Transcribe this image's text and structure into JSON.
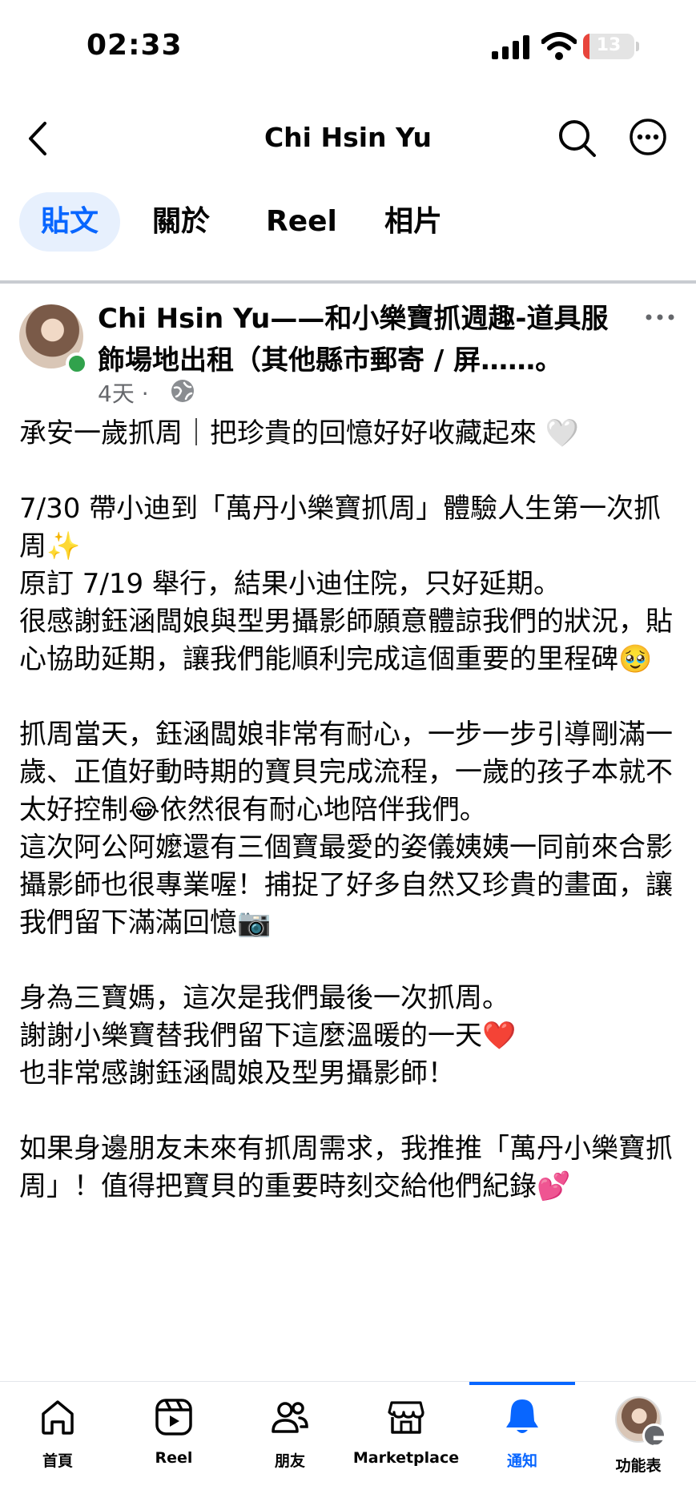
{
  "status_bar": {
    "time": "02:33",
    "battery": "13",
    "battery_level": 0.13
  },
  "header": {
    "title": "Chi Hsin Yu"
  },
  "tabs": [
    {
      "label": "貼文",
      "active": true
    },
    {
      "label": "關於"
    },
    {
      "label": "Reel"
    },
    {
      "label": "相片"
    }
  ],
  "post": {
    "author_line": "Chi Hsin Yu——和小樂寶抓週趣-道具服飾場地出租（其他縣市郵寄 / 屏……。",
    "time": "4天",
    "separator": "·",
    "body": "承安一歲抓周｜把珍貴的回憶好好收藏起來 🤍\n\n7/30 帶小迪到「萬丹小樂寶抓周」體驗人生第一次抓周✨\n原訂 7/19 舉行，結果小迪住院，只好延期。\n很感謝鈺涵闆娘與型男攝影師願意體諒我們的狀況，貼心協助延期，讓我們能順利完成這個重要的里程碑🥹\n\n抓周當天，鈺涵闆娘非常有耐心，一步一步引導剛滿一歲、正值好動時期的寶貝完成流程，一歲的孩子本就不太好控制😂依然很有耐心地陪伴我們。\n這次阿公阿嬤還有三個寶最愛的姿儀姨姨一同前來合影\n攝影師也很專業喔！捕捉了好多自然又珍貴的畫面，讓我們留下滿滿回憶📷\n\n身為三寶媽，這次是我們最後一次抓周。\n謝謝小樂寶替我們留下這麼溫暖的一天❤️\n也非常感謝鈺涵闆娘及型男攝影師！\n\n如果身邊朋友未來有抓周需求，我推推「萬丹小樂寶抓周」！值得把寶貝的重要時刻交給他們紀錄💕"
  },
  "bottom_nav": [
    {
      "label": "首頁",
      "icon": "home-icon"
    },
    {
      "label": "Reel",
      "icon": "reel-icon"
    },
    {
      "label": "朋友",
      "icon": "friends-icon"
    },
    {
      "label": "Marketplace",
      "icon": "marketplace-icon"
    },
    {
      "label": "通知",
      "icon": "bell-icon",
      "active": true
    },
    {
      "label": "功能表",
      "icon": "menu-avatar"
    }
  ],
  "colors": {
    "accent": "#0866ff",
    "tab_active_bg": "#e7f0fd",
    "meta": "#65676b",
    "online": "#31a24c"
  }
}
